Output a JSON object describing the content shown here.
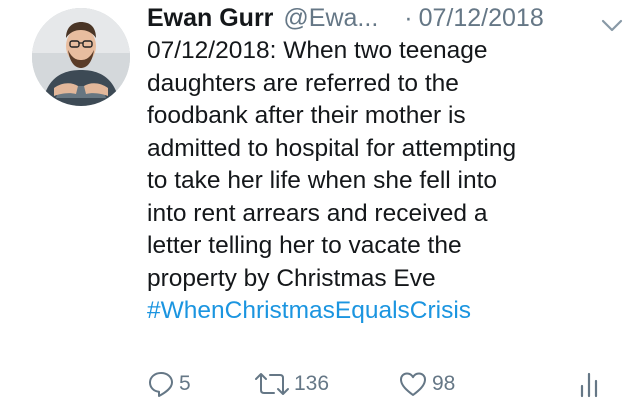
{
  "tweet": {
    "author_name": "Ewan Gurr",
    "handle": "@Ewa...",
    "separator": "·",
    "date": "07/12/2018",
    "text_lines": [
      "07/12/2018: When two teenage",
      "daughters are referred to the",
      "foodbank after their mother is",
      "admitted to hospital for attempting",
      "to take her life when she fell into",
      "into rent arrears and received a",
      "letter telling her to vacate the",
      "property by Christmas Eve"
    ],
    "hashtag": "#WhenChristmasEqualsCrisis",
    "replies": "5",
    "retweets": "136",
    "likes": "98"
  },
  "icons": {
    "reply": "reply-icon",
    "retweet": "retweet-icon",
    "like": "heart-icon",
    "analytics": "analytics-icon",
    "menu": "chevron-down-icon"
  },
  "colors": {
    "text": "#14171a",
    "muted": "#657786",
    "link": "#1b95e0",
    "background": "#ffffff"
  }
}
